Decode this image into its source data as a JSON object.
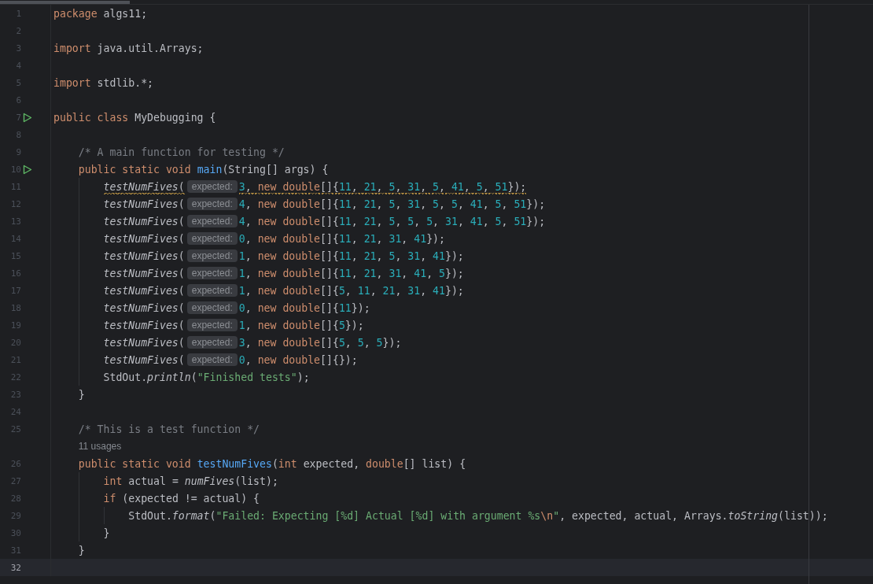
{
  "editor": {
    "lines": [
      {
        "kind": "code",
        "number": "1",
        "run": false,
        "current": false,
        "warning": false,
        "tokens": [
          {
            "kind": "kw",
            "text": "package"
          },
          {
            "kind": "id",
            "text": " algs11;"
          }
        ]
      },
      {
        "kind": "code",
        "number": "2",
        "run": false,
        "current": false
      },
      {
        "kind": "code",
        "number": "3",
        "run": false,
        "current": false,
        "warning": false,
        "tokens": [
          {
            "kind": "kw",
            "text": "import"
          },
          {
            "kind": "id",
            "text": " java.util.Arrays;"
          }
        ]
      },
      {
        "kind": "code",
        "number": "4",
        "run": false,
        "current": false
      },
      {
        "kind": "code",
        "number": "5",
        "run": false,
        "current": false,
        "warning": false,
        "tokens": [
          {
            "kind": "kw",
            "text": "import"
          },
          {
            "kind": "id",
            "text": " stdlib.*;"
          }
        ]
      },
      {
        "kind": "code",
        "number": "6",
        "run": false,
        "current": false
      },
      {
        "kind": "code",
        "number": "7",
        "run": true,
        "current": false,
        "warning": false,
        "tokens": [
          {
            "kind": "kw",
            "text": "public class"
          },
          {
            "kind": "id",
            "text": " MyDebugging {"
          }
        ]
      },
      {
        "kind": "code",
        "number": "8",
        "run": false,
        "current": false
      },
      {
        "kind": "code",
        "number": "9",
        "run": false,
        "current": false,
        "warning": false,
        "tokens": [
          {
            "kind": "cmt",
            "text": "    /* A main function for testing */"
          }
        ]
      },
      {
        "kind": "code",
        "number": "10",
        "run": true,
        "current": false,
        "warning": false,
        "tokens": [
          {
            "kind": "kw",
            "text": "    public static void "
          },
          {
            "kind": "decl",
            "text": "main"
          },
          {
            "kind": "id",
            "text": "(String[] args) {"
          }
        ]
      },
      {
        "kind": "code",
        "number": "11",
        "run": false,
        "current": false,
        "warning": true,
        "tokens": [
          {
            "kind": "call",
            "text": "        testNumFives"
          },
          {
            "kind": "id",
            "text": "("
          },
          {
            "kind": "hint",
            "text": "expected:"
          },
          {
            "kind": "num",
            "text": "3"
          },
          {
            "kind": "id",
            "text": ", "
          },
          {
            "kind": "kw",
            "text": "new double"
          },
          {
            "kind": "id",
            "text": "[]{"
          },
          {
            "kind": "num",
            "text": "11"
          },
          {
            "kind": "id",
            "text": ", "
          },
          {
            "kind": "num",
            "text": "21"
          },
          {
            "kind": "id",
            "text": ", "
          },
          {
            "kind": "num",
            "text": "5"
          },
          {
            "kind": "id",
            "text": ", "
          },
          {
            "kind": "num",
            "text": "31"
          },
          {
            "kind": "id",
            "text": ", "
          },
          {
            "kind": "num",
            "text": "5"
          },
          {
            "kind": "id",
            "text": ", "
          },
          {
            "kind": "num",
            "text": "41"
          },
          {
            "kind": "id",
            "text": ", "
          },
          {
            "kind": "num",
            "text": "5"
          },
          {
            "kind": "id",
            "text": ", "
          },
          {
            "kind": "num",
            "text": "51"
          },
          {
            "kind": "id",
            "text": "});"
          }
        ]
      },
      {
        "kind": "code",
        "number": "12",
        "run": false,
        "current": false,
        "warning": false,
        "tokens": [
          {
            "kind": "call",
            "text": "        testNumFives"
          },
          {
            "kind": "id",
            "text": "("
          },
          {
            "kind": "hint",
            "text": "expected:"
          },
          {
            "kind": "num",
            "text": "4"
          },
          {
            "kind": "id",
            "text": ", "
          },
          {
            "kind": "kw",
            "text": "new double"
          },
          {
            "kind": "id",
            "text": "[]{"
          },
          {
            "kind": "num",
            "text": "11"
          },
          {
            "kind": "id",
            "text": ", "
          },
          {
            "kind": "num",
            "text": "21"
          },
          {
            "kind": "id",
            "text": ", "
          },
          {
            "kind": "num",
            "text": "5"
          },
          {
            "kind": "id",
            "text": ", "
          },
          {
            "kind": "num",
            "text": "31"
          },
          {
            "kind": "id",
            "text": ", "
          },
          {
            "kind": "num",
            "text": "5"
          },
          {
            "kind": "id",
            "text": ", "
          },
          {
            "kind": "num",
            "text": "5"
          },
          {
            "kind": "id",
            "text": ", "
          },
          {
            "kind": "num",
            "text": "41"
          },
          {
            "kind": "id",
            "text": ", "
          },
          {
            "kind": "num",
            "text": "5"
          },
          {
            "kind": "id",
            "text": ", "
          },
          {
            "kind": "num",
            "text": "51"
          },
          {
            "kind": "id",
            "text": "});"
          }
        ]
      },
      {
        "kind": "code",
        "number": "13",
        "run": false,
        "current": false,
        "warning": false,
        "tokens": [
          {
            "kind": "call",
            "text": "        testNumFives"
          },
          {
            "kind": "id",
            "text": "("
          },
          {
            "kind": "hint",
            "text": "expected:"
          },
          {
            "kind": "num",
            "text": "4"
          },
          {
            "kind": "id",
            "text": ", "
          },
          {
            "kind": "kw",
            "text": "new double"
          },
          {
            "kind": "id",
            "text": "[]{"
          },
          {
            "kind": "num",
            "text": "11"
          },
          {
            "kind": "id",
            "text": ", "
          },
          {
            "kind": "num",
            "text": "21"
          },
          {
            "kind": "id",
            "text": ", "
          },
          {
            "kind": "num",
            "text": "5"
          },
          {
            "kind": "id",
            "text": ", "
          },
          {
            "kind": "num",
            "text": "5"
          },
          {
            "kind": "id",
            "text": ", "
          },
          {
            "kind": "num",
            "text": "5"
          },
          {
            "kind": "id",
            "text": ", "
          },
          {
            "kind": "num",
            "text": "31"
          },
          {
            "kind": "id",
            "text": ", "
          },
          {
            "kind": "num",
            "text": "41"
          },
          {
            "kind": "id",
            "text": ", "
          },
          {
            "kind": "num",
            "text": "5"
          },
          {
            "kind": "id",
            "text": ", "
          },
          {
            "kind": "num",
            "text": "51"
          },
          {
            "kind": "id",
            "text": "});"
          }
        ]
      },
      {
        "kind": "code",
        "number": "14",
        "run": false,
        "current": false,
        "warning": false,
        "tokens": [
          {
            "kind": "call",
            "text": "        testNumFives"
          },
          {
            "kind": "id",
            "text": "("
          },
          {
            "kind": "hint",
            "text": "expected:"
          },
          {
            "kind": "num",
            "text": "0"
          },
          {
            "kind": "id",
            "text": ", "
          },
          {
            "kind": "kw",
            "text": "new double"
          },
          {
            "kind": "id",
            "text": "[]{"
          },
          {
            "kind": "num",
            "text": "11"
          },
          {
            "kind": "id",
            "text": ", "
          },
          {
            "kind": "num",
            "text": "21"
          },
          {
            "kind": "id",
            "text": ", "
          },
          {
            "kind": "num",
            "text": "31"
          },
          {
            "kind": "id",
            "text": ", "
          },
          {
            "kind": "num",
            "text": "41"
          },
          {
            "kind": "id",
            "text": "});"
          }
        ]
      },
      {
        "kind": "code",
        "number": "15",
        "run": false,
        "current": false,
        "warning": false,
        "tokens": [
          {
            "kind": "call",
            "text": "        testNumFives"
          },
          {
            "kind": "id",
            "text": "("
          },
          {
            "kind": "hint",
            "text": "expected:"
          },
          {
            "kind": "num",
            "text": "1"
          },
          {
            "kind": "id",
            "text": ", "
          },
          {
            "kind": "kw",
            "text": "new double"
          },
          {
            "kind": "id",
            "text": "[]{"
          },
          {
            "kind": "num",
            "text": "11"
          },
          {
            "kind": "id",
            "text": ", "
          },
          {
            "kind": "num",
            "text": "21"
          },
          {
            "kind": "id",
            "text": ", "
          },
          {
            "kind": "num",
            "text": "5"
          },
          {
            "kind": "id",
            "text": ", "
          },
          {
            "kind": "num",
            "text": "31"
          },
          {
            "kind": "id",
            "text": ", "
          },
          {
            "kind": "num",
            "text": "41"
          },
          {
            "kind": "id",
            "text": "});"
          }
        ]
      },
      {
        "kind": "code",
        "number": "16",
        "run": false,
        "current": false,
        "warning": false,
        "tokens": [
          {
            "kind": "call",
            "text": "        testNumFives"
          },
          {
            "kind": "id",
            "text": "("
          },
          {
            "kind": "hint",
            "text": "expected:"
          },
          {
            "kind": "num",
            "text": "1"
          },
          {
            "kind": "id",
            "text": ", "
          },
          {
            "kind": "kw",
            "text": "new double"
          },
          {
            "kind": "id",
            "text": "[]{"
          },
          {
            "kind": "num",
            "text": "11"
          },
          {
            "kind": "id",
            "text": ", "
          },
          {
            "kind": "num",
            "text": "21"
          },
          {
            "kind": "id",
            "text": ", "
          },
          {
            "kind": "num",
            "text": "31"
          },
          {
            "kind": "id",
            "text": ", "
          },
          {
            "kind": "num",
            "text": "41"
          },
          {
            "kind": "id",
            "text": ", "
          },
          {
            "kind": "num",
            "text": "5"
          },
          {
            "kind": "id",
            "text": "});"
          }
        ]
      },
      {
        "kind": "code",
        "number": "17",
        "run": false,
        "current": false,
        "warning": false,
        "tokens": [
          {
            "kind": "call",
            "text": "        testNumFives"
          },
          {
            "kind": "id",
            "text": "("
          },
          {
            "kind": "hint",
            "text": "expected:"
          },
          {
            "kind": "num",
            "text": "1"
          },
          {
            "kind": "id",
            "text": ", "
          },
          {
            "kind": "kw",
            "text": "new double"
          },
          {
            "kind": "id",
            "text": "[]{"
          },
          {
            "kind": "num",
            "text": "5"
          },
          {
            "kind": "id",
            "text": ", "
          },
          {
            "kind": "num",
            "text": "11"
          },
          {
            "kind": "id",
            "text": ", "
          },
          {
            "kind": "num",
            "text": "21"
          },
          {
            "kind": "id",
            "text": ", "
          },
          {
            "kind": "num",
            "text": "31"
          },
          {
            "kind": "id",
            "text": ", "
          },
          {
            "kind": "num",
            "text": "41"
          },
          {
            "kind": "id",
            "text": "});"
          }
        ]
      },
      {
        "kind": "code",
        "number": "18",
        "run": false,
        "current": false,
        "warning": false,
        "tokens": [
          {
            "kind": "call",
            "text": "        testNumFives"
          },
          {
            "kind": "id",
            "text": "("
          },
          {
            "kind": "hint",
            "text": "expected:"
          },
          {
            "kind": "num",
            "text": "0"
          },
          {
            "kind": "id",
            "text": ", "
          },
          {
            "kind": "kw",
            "text": "new double"
          },
          {
            "kind": "id",
            "text": "[]{"
          },
          {
            "kind": "num",
            "text": "11"
          },
          {
            "kind": "id",
            "text": "});"
          }
        ]
      },
      {
        "kind": "code",
        "number": "19",
        "run": false,
        "current": false,
        "warning": false,
        "tokens": [
          {
            "kind": "call",
            "text": "        testNumFives"
          },
          {
            "kind": "id",
            "text": "("
          },
          {
            "kind": "hint",
            "text": "expected:"
          },
          {
            "kind": "num",
            "text": "1"
          },
          {
            "kind": "id",
            "text": ", "
          },
          {
            "kind": "kw",
            "text": "new double"
          },
          {
            "kind": "id",
            "text": "[]{"
          },
          {
            "kind": "num",
            "text": "5"
          },
          {
            "kind": "id",
            "text": "});"
          }
        ]
      },
      {
        "kind": "code",
        "number": "20",
        "run": false,
        "current": false,
        "warning": false,
        "tokens": [
          {
            "kind": "call",
            "text": "        testNumFives"
          },
          {
            "kind": "id",
            "text": "("
          },
          {
            "kind": "hint",
            "text": "expected:"
          },
          {
            "kind": "num",
            "text": "3"
          },
          {
            "kind": "id",
            "text": ", "
          },
          {
            "kind": "kw",
            "text": "new double"
          },
          {
            "kind": "id",
            "text": "[]{"
          },
          {
            "kind": "num",
            "text": "5"
          },
          {
            "kind": "id",
            "text": ", "
          },
          {
            "kind": "num",
            "text": "5"
          },
          {
            "kind": "id",
            "text": ", "
          },
          {
            "kind": "num",
            "text": "5"
          },
          {
            "kind": "id",
            "text": "});"
          }
        ]
      },
      {
        "kind": "code",
        "number": "21",
        "run": false,
        "current": false,
        "warning": false,
        "tokens": [
          {
            "kind": "call",
            "text": "        testNumFives"
          },
          {
            "kind": "id",
            "text": "("
          },
          {
            "kind": "hint",
            "text": "expected:"
          },
          {
            "kind": "num",
            "text": "0"
          },
          {
            "kind": "id",
            "text": ", "
          },
          {
            "kind": "kw",
            "text": "new double"
          },
          {
            "kind": "id",
            "text": "[]{});"
          }
        ]
      },
      {
        "kind": "code",
        "number": "22",
        "run": false,
        "current": false,
        "warning": false,
        "tokens": [
          {
            "kind": "id",
            "text": "        StdOut."
          },
          {
            "kind": "call",
            "text": "println"
          },
          {
            "kind": "id",
            "text": "("
          },
          {
            "kind": "str",
            "text": "\"Finished tests\""
          },
          {
            "kind": "id",
            "text": ");"
          }
        ]
      },
      {
        "kind": "code",
        "number": "23",
        "run": false,
        "current": false,
        "warning": false,
        "tokens": [
          {
            "kind": "id",
            "text": "    }"
          }
        ]
      },
      {
        "kind": "code",
        "number": "24",
        "run": false,
        "current": false
      },
      {
        "kind": "code",
        "number": "25",
        "run": false,
        "current": false,
        "warning": false,
        "tokens": [
          {
            "kind": "cmt",
            "text": "    /* This is a test function */"
          }
        ]
      },
      {
        "kind": "usages",
        "text": "11 usages"
      },
      {
        "kind": "code",
        "number": "26",
        "run": false,
        "current": false,
        "warning": false,
        "tokens": [
          {
            "kind": "kw",
            "text": "    public static void "
          },
          {
            "kind": "decl",
            "text": "testNumFives"
          },
          {
            "kind": "id",
            "text": "("
          },
          {
            "kind": "kw",
            "text": "int"
          },
          {
            "kind": "id",
            "text": " expected, "
          },
          {
            "kind": "kw",
            "text": "double"
          },
          {
            "kind": "id",
            "text": "[] list) {"
          }
        ]
      },
      {
        "kind": "code",
        "number": "27",
        "run": false,
        "current": false,
        "warning": false,
        "tokens": [
          {
            "kind": "kw",
            "text": "        int"
          },
          {
            "kind": "id",
            "text": " actual = "
          },
          {
            "kind": "call",
            "text": "numFives"
          },
          {
            "kind": "id",
            "text": "(list);"
          }
        ]
      },
      {
        "kind": "code",
        "number": "28",
        "run": false,
        "current": false,
        "warning": false,
        "tokens": [
          {
            "kind": "kw",
            "text": "        if"
          },
          {
            "kind": "id",
            "text": " (expected != actual) {"
          }
        ]
      },
      {
        "kind": "code",
        "number": "29",
        "run": false,
        "current": false,
        "warning": false,
        "tokens": [
          {
            "kind": "id",
            "text": "            StdOut."
          },
          {
            "kind": "call",
            "text": "format"
          },
          {
            "kind": "id",
            "text": "("
          },
          {
            "kind": "str",
            "text": "\"Failed: Expecting [%d] Actual [%d] with argument %s"
          },
          {
            "kind": "esc",
            "text": "\\n"
          },
          {
            "kind": "str",
            "text": "\""
          },
          {
            "kind": "id",
            "text": ", expected, actual, Arrays."
          },
          {
            "kind": "call",
            "text": "toString"
          },
          {
            "kind": "id",
            "text": "(list));"
          }
        ]
      },
      {
        "kind": "code",
        "number": "30",
        "run": false,
        "current": false,
        "warning": false,
        "tokens": [
          {
            "kind": "id",
            "text": "        }"
          }
        ]
      },
      {
        "kind": "code",
        "number": "31",
        "run": false,
        "current": false,
        "warning": false,
        "tokens": [
          {
            "kind": "id",
            "text": "    }"
          }
        ]
      },
      {
        "kind": "code",
        "number": "32",
        "run": false,
        "current": true
      }
    ]
  }
}
